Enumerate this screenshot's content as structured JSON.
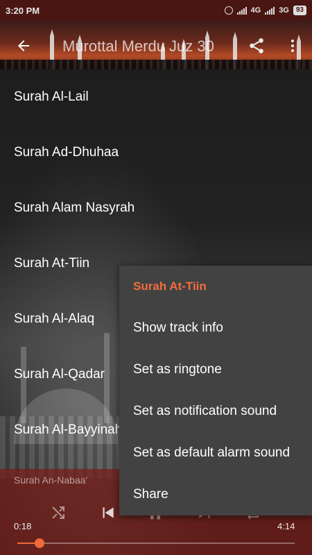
{
  "status_bar": {
    "time": "3:20 PM",
    "network_1": "4G",
    "network_2": "3G",
    "battery": "93"
  },
  "header": {
    "title": "Murottal Merdu Juz 30",
    "back_icon": "arrow-left-icon",
    "share_icon": "share-icon",
    "more_icon": "more-vert-icon"
  },
  "list": {
    "items": [
      {
        "label": "Surah Al-Lail"
      },
      {
        "label": "Surah Ad-Dhuhaa"
      },
      {
        "label": "Surah Alam Nasyrah"
      },
      {
        "label": "Surah At-Tiin"
      },
      {
        "label": "Surah Al-Alaq"
      },
      {
        "label": "Surah Al-Qadar"
      },
      {
        "label": "Surah Al-Bayyinah"
      }
    ]
  },
  "player": {
    "now_playing": "Surah An-Nabaa'",
    "current_time": "0:18",
    "total_time": "4:14",
    "progress": 0.08,
    "controls": [
      "shuffle-icon",
      "skip-previous-icon",
      "pause-icon",
      "skip-next-icon",
      "repeat-icon"
    ]
  },
  "context_menu": {
    "title": "Surah At-Tiin",
    "items": [
      {
        "label": "Show track info"
      },
      {
        "label": "Set as ringtone"
      },
      {
        "label": "Set as notification sound"
      },
      {
        "label": "Set as default alarm sound"
      },
      {
        "label": "Share"
      }
    ]
  },
  "colors": {
    "accent": "#f26d3d",
    "status_bar": "#4a1612",
    "menu_bg": "#424242"
  }
}
